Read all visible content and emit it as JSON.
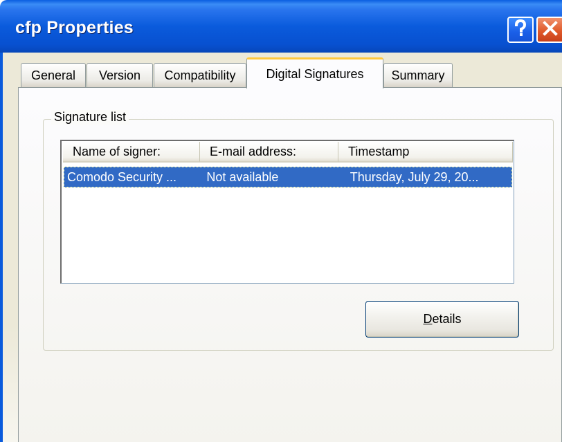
{
  "window": {
    "title": "cfp Properties"
  },
  "titlebar_buttons": {
    "help_icon": "question-mark",
    "close_icon": "x-mark"
  },
  "tabs": [
    {
      "label": "General",
      "active": false
    },
    {
      "label": "Version",
      "active": false
    },
    {
      "label": "Compatibility",
      "active": false
    },
    {
      "label": "Digital Signatures",
      "active": true
    },
    {
      "label": "Summary",
      "active": false
    }
  ],
  "signature_group": {
    "label": "Signature list",
    "columns": [
      "Name of signer:",
      "E-mail address:",
      "Timestamp"
    ],
    "rows": [
      {
        "signer": "Comodo Security ...",
        "email": "Not available",
        "timestamp": "Thursday, July 29, 20...",
        "selected": true
      }
    ]
  },
  "buttons": {
    "details_mnemonic": "D",
    "details_rest": "etails"
  },
  "colors": {
    "titlebar": "#0a5bdc",
    "selection": "#316ac5",
    "active_tab_accent": "#ffc83c",
    "close_button": "#e05a2a"
  }
}
